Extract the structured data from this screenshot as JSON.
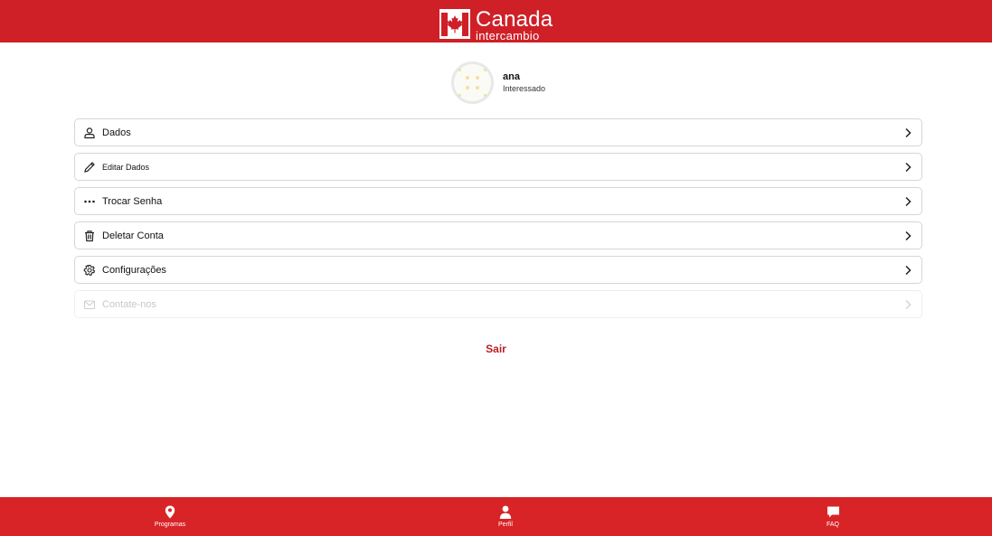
{
  "header": {
    "brand_main": "Canada",
    "brand_sub": "intercambio",
    "colors": {
      "background": "#cf2027",
      "text": "#ffffff"
    }
  },
  "profile": {
    "name": "ana",
    "role": "Interessado"
  },
  "menu": {
    "items": [
      {
        "label": "Dados",
        "icon": "user-icon"
      },
      {
        "label": "Editar Dados",
        "icon": "pencil-icon"
      },
      {
        "label": "Trocar Senha",
        "icon": "dots-icon"
      },
      {
        "label": "Deletar Conta",
        "icon": "trash-icon"
      },
      {
        "label": "Configurações",
        "icon": "gear-icon"
      },
      {
        "label": "Contate-nos",
        "icon": "mail-icon",
        "disabled": true
      }
    ]
  },
  "logout": {
    "label": "Sair",
    "color": "#b8202a"
  },
  "bottom_nav": {
    "items": [
      {
        "label": "Programas",
        "icon": "map-pin-icon"
      },
      {
        "label": "Perfil",
        "icon": "person-icon"
      },
      {
        "label": "FAQ",
        "icon": "chat-icon"
      }
    ],
    "colors": {
      "background": "#d92427",
      "text": "#ffffff"
    }
  }
}
